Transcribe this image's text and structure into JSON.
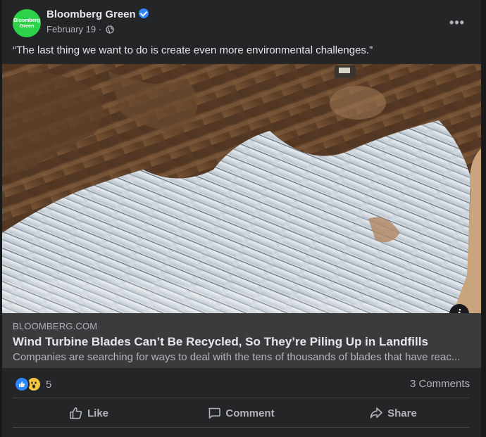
{
  "header": {
    "avatar_line1": "Bloomberg",
    "avatar_line2": "Green",
    "page_name": "Bloomberg Green",
    "date": "February 19 ·",
    "more_label": "•••"
  },
  "post": {
    "text": "“The last thing we want to do is create even more environmental challenges.”"
  },
  "photo": {
    "info_label": "i"
  },
  "link": {
    "domain": "BLOOMBERG.COM",
    "title": "Wind Turbine Blades Can’t Be Recycled, So They’re Piling Up in Landfills",
    "description": "Companies are searching for ways to deal with the tens of thousands of blades that have reac..."
  },
  "stats": {
    "reaction_count": "5",
    "comments": "3 Comments"
  },
  "actions": {
    "like": "Like",
    "comment": "Comment",
    "share": "Share"
  },
  "colors": {
    "card_bg": "#242526",
    "link_bg": "#3a3b3c",
    "accent_blue": "#2d88ff",
    "avatar_green": "#2bd24a"
  }
}
